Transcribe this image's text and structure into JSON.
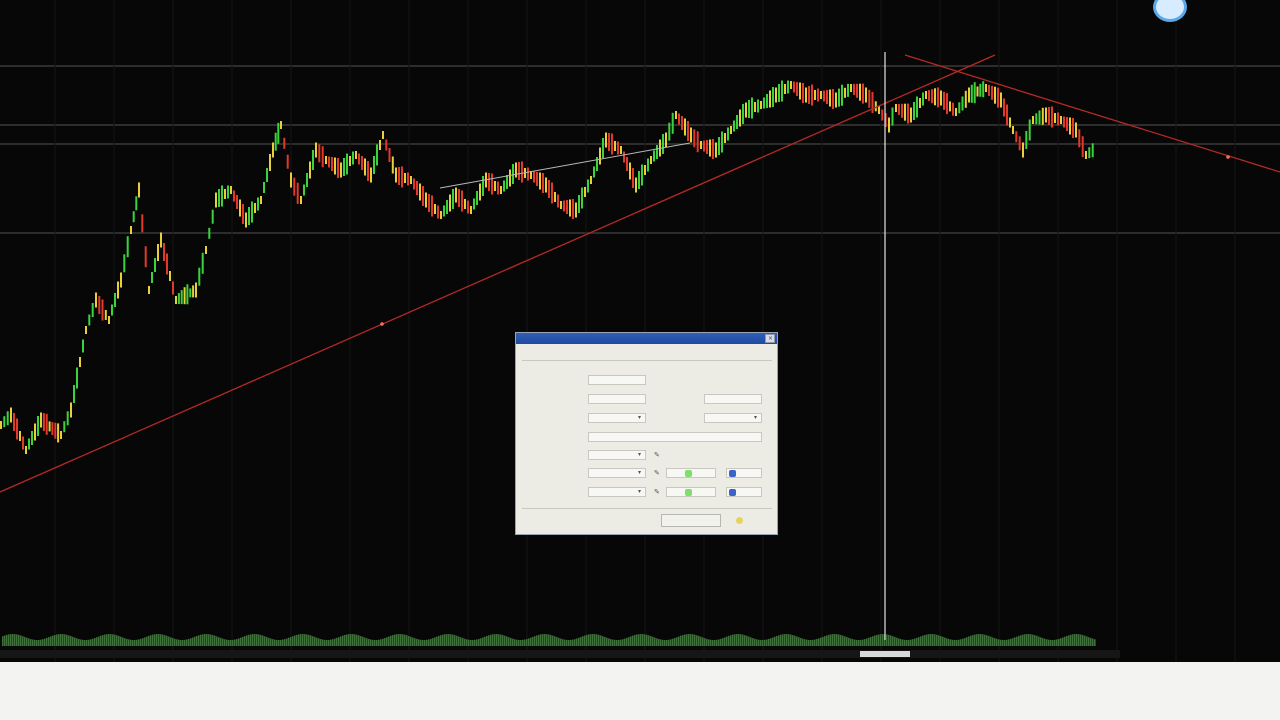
{
  "status_bar": {
    "time_labels": [
      "",
      "",
      "",
      "",
      "",
      "",
      "",
      "",
      "",
      "",
      "",
      ""
    ],
    "left_text": ""
  },
  "dialog": {
    "title": "",
    "tabs": [
      "",
      ""
    ],
    "fields": {
      "name_label": "",
      "type_label": "",
      "text_label": "",
      "color_label": "",
      "width_label": "",
      "style_label": "",
      "left_price_label": "",
      "right_price_label": ""
    },
    "buttons": {
      "apply": "",
      "ok": "",
      "help": ""
    }
  },
  "chart": {
    "background": "#070708",
    "up_color": "#39d33b",
    "down_color": "#e2392b",
    "neutral_color": "#e7d038",
    "trendline_color": "#b52a26",
    "cursor_line_color": "#e6e6e6",
    "volume_color": "#3f6f3a",
    "icons": [
      "cursor-dot-icon"
    ]
  }
}
